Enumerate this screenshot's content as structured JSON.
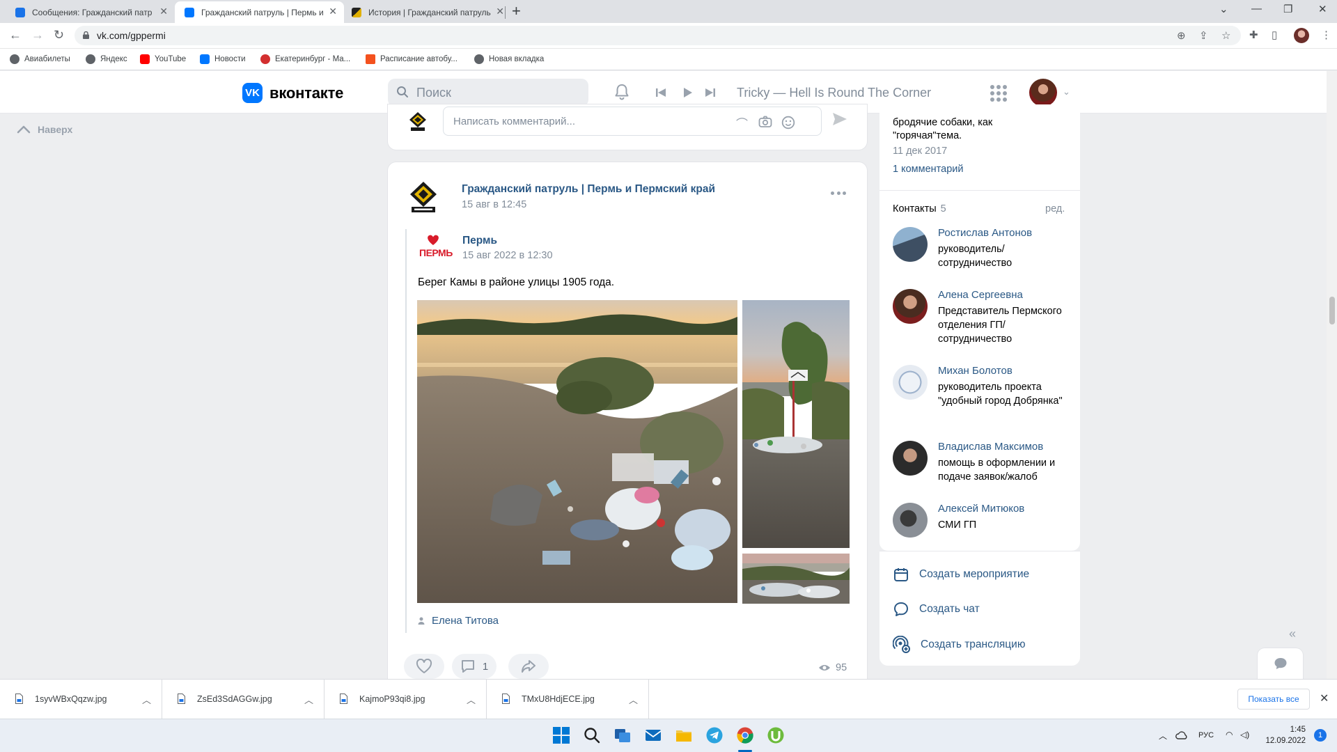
{
  "browser": {
    "tabs": [
      {
        "title": "Сообщения: Гражданский патр",
        "icon": "message-icon",
        "active": false
      },
      {
        "title": "Гражданский патруль | Пермь и",
        "icon": "vk-icon",
        "active": true
      },
      {
        "title": "История | Гражданский патруль",
        "icon": "patrol-icon",
        "active": false
      }
    ],
    "url": "vk.com/gppermi",
    "bookmarks": [
      "Авиабилеты",
      "Яндекс",
      "YouTube",
      "Новости",
      "Екатеринбург - Ма...",
      "Расписание автобу...",
      "Новая вкладка"
    ]
  },
  "vk": {
    "logo_text": "вконтакте",
    "search_placeholder": "Поиск",
    "player_track": "Tricky — Hell Is Round The Corner",
    "to_top": "Наверх",
    "comment_placeholder": "Написать комментарий...",
    "post": {
      "author": "Гражданский патруль | Пермь и Пермский край",
      "date": "15 авг в 12:45",
      "repost": {
        "logo_text": "ПЕРМЬ",
        "author": "Пермь",
        "date": "15 авг 2022 в 12:30",
        "text": "Берег Камы в районе улицы 1905 года.",
        "signer": "Елена Титова"
      },
      "comments_count": "1",
      "views": "95"
    },
    "sidebar": {
      "discussion_text_line1": "бродячие собаки, как",
      "discussion_text_line2": "\"горячая\"тема.",
      "discussion_date": "11 дек 2017",
      "discussion_comments": "1 комментарий",
      "contacts_title": "Контакты",
      "contacts_count": "5",
      "contacts_edit": "ред.",
      "contacts": [
        {
          "name": "Ростислав Антонов",
          "role": "руководитель/ сотрудничество"
        },
        {
          "name": "Алена Сергеевна",
          "role": "Представитель Пермского отделения ГП/сотрудничество"
        },
        {
          "name": "Михан Болотов",
          "role": "руководитель проекта \"удобный город Добрянка\""
        },
        {
          "name": "Владислав Максимов",
          "role": "помощь в оформлении и подаче заявок/жалоб"
        },
        {
          "name": "Алексей Митюков",
          "role": "СМИ ГП"
        }
      ],
      "actions": [
        "Создать мероприятие",
        "Создать чат",
        "Создать трансляцию"
      ]
    }
  },
  "downloads": {
    "files": [
      "1syvWBxQqzw.jpg",
      "ZsEd3SdAGGw.jpg",
      "KajmoP93qi8.jpg",
      "TMxU8HdjECE.jpg"
    ],
    "show_all": "Показать все"
  },
  "taskbar": {
    "language": "РУС",
    "time": "1:45",
    "date": "12.09.2022",
    "notifications": "1"
  },
  "colors": {
    "vk_blue": "#0077ff",
    "link": "#2a5885",
    "muted": "#818c99",
    "page_bg": "#edeef0"
  }
}
